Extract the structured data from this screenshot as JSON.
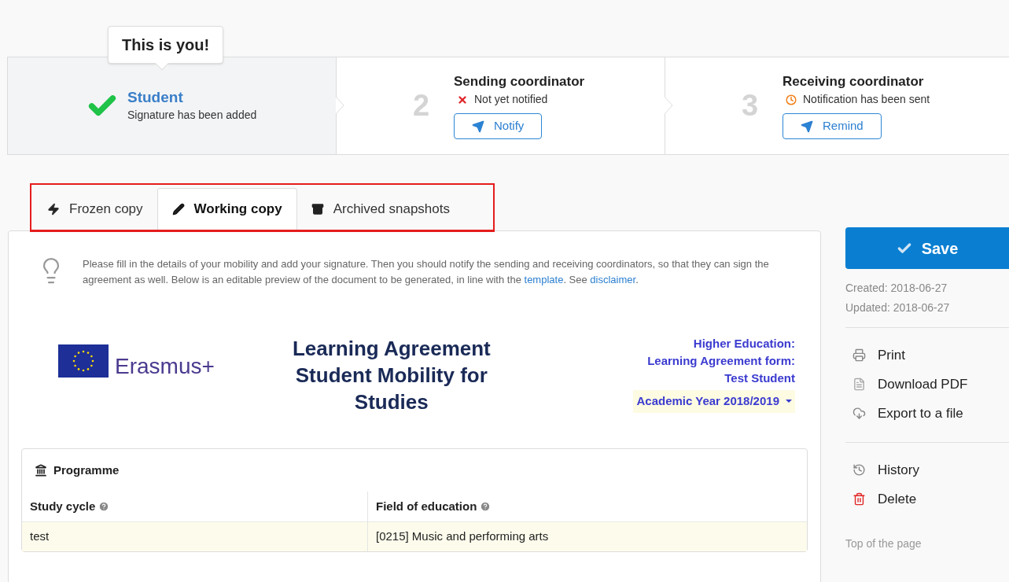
{
  "steps": [
    {
      "kind": "done",
      "title": "Student",
      "status": "Signature has been added",
      "selected": true,
      "tooltip": "This is you!"
    },
    {
      "number": "2",
      "kind": "not_notified",
      "title": "Sending coordinator",
      "status": "Not yet notified",
      "button": "Notify",
      "selected": false
    },
    {
      "number": "3",
      "kind": "sent",
      "title": "Receiving coordinator",
      "status": "Notification has been sent",
      "button": "Remind",
      "selected": false
    }
  ],
  "tabs": [
    {
      "label": "Frozen copy",
      "kind": "bolt",
      "selected": false
    },
    {
      "label": "Working copy",
      "kind": "pencil",
      "selected": true
    },
    {
      "label": "Archived snapshots",
      "kind": "archive",
      "selected": false
    }
  ],
  "info": [
    {
      "kind": "text",
      "text": "Please fill in the details of your mobility and add your signature. Then you should notify the sending and receiving coordinators, so that they can sign the agreement as well. Below is an editable preview of the document to be generated, in line with the "
    },
    {
      "kind": "link",
      "text": "template"
    },
    {
      "kind": "text",
      "text": ". See "
    },
    {
      "kind": "link",
      "text": "disclaimer"
    },
    {
      "kind": "text",
      "text": "."
    }
  ],
  "document": {
    "logo": "Erasmus+",
    "title": "Learning Agreement Student Mobility for Studies",
    "form_lines": [
      "Higher Education:",
      "Learning Agreement form:",
      "Test Student"
    ],
    "academic_year": "Academic Year 2018/2019"
  },
  "programme": {
    "title": "Programme",
    "columns": [
      "Study cycle",
      "Field of education"
    ],
    "rows": [
      [
        "test",
        "[0215] Music and performing arts"
      ]
    ]
  },
  "sidebar": {
    "save": "Save",
    "created": "Created: 2018-06-27",
    "updated": "Updated: 2018-06-27",
    "groups": [
      [
        {
          "label": "Print",
          "kind": "print"
        },
        {
          "label": "Download PDF",
          "kind": "pdf"
        },
        {
          "label": "Export to a file",
          "kind": "cloud"
        }
      ],
      [
        {
          "label": "History",
          "kind": "history"
        },
        {
          "label": "Delete",
          "kind": "delete"
        }
      ]
    ],
    "top_link": "Top of the page"
  }
}
